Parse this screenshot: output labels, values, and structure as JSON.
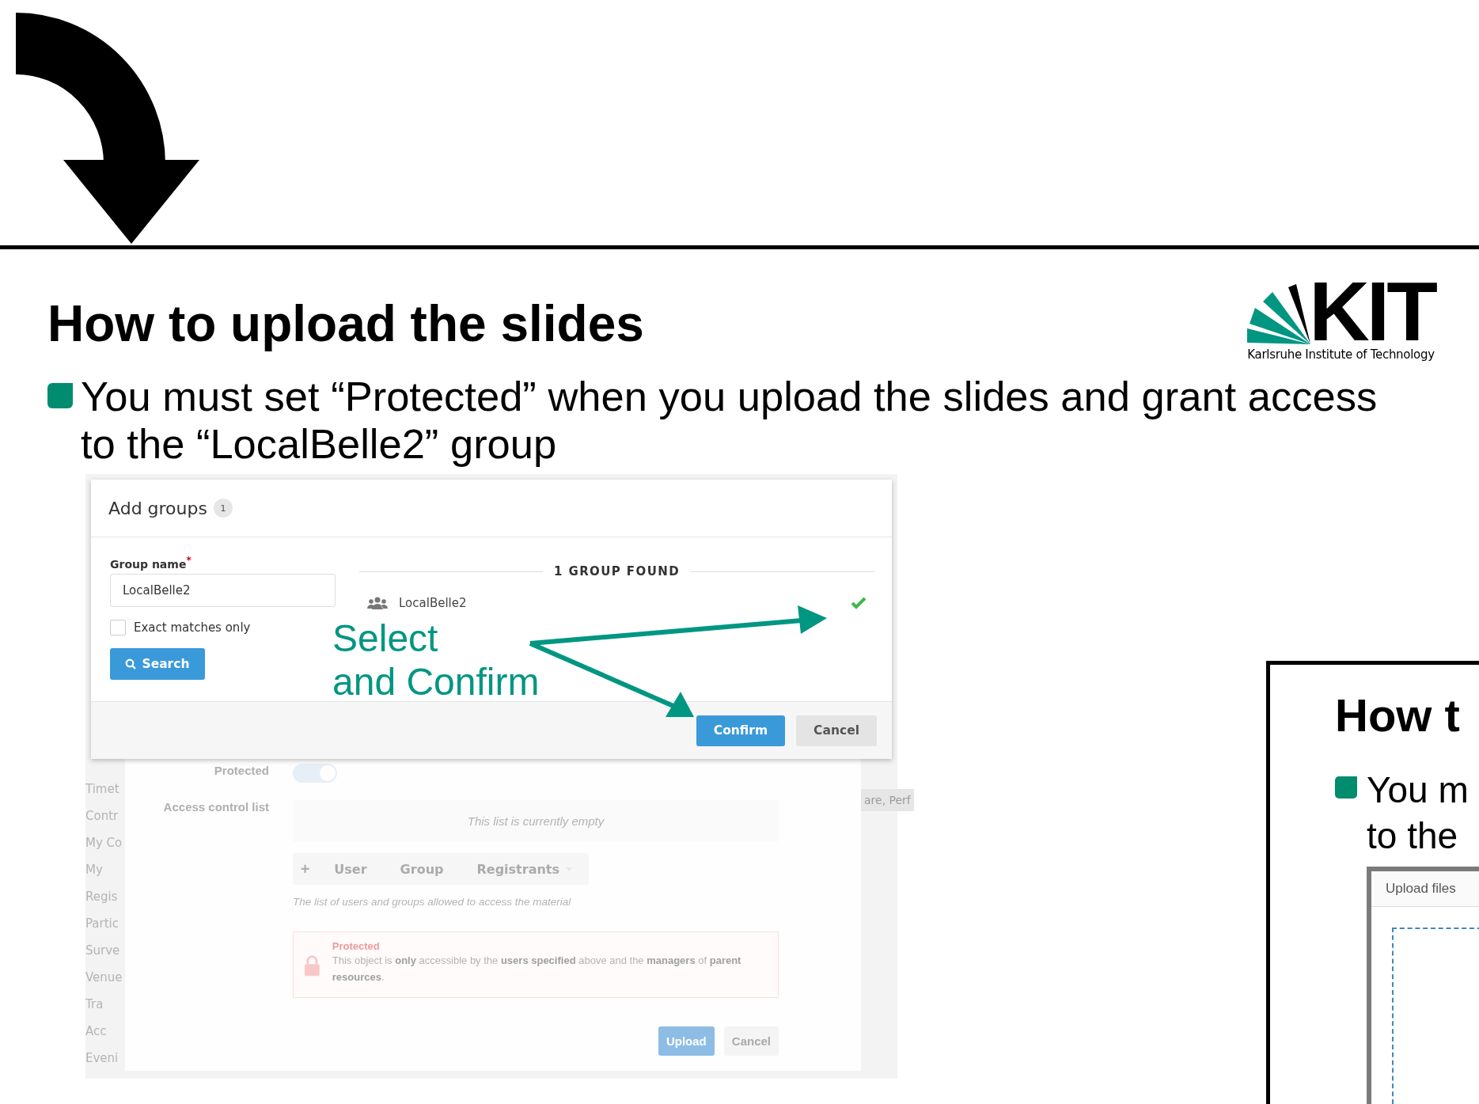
{
  "slide": {
    "title": "How to upload the slides",
    "bullet": "You must set “Protected” when you upload the slides and grant access to the “LocalBelle2” group",
    "logo": {
      "wordmark": "KIT",
      "subtitle": "Karlsruhe Institute of Technology"
    }
  },
  "screenshot": {
    "dialog": {
      "title": "Add groups",
      "count": "1",
      "field_label": "Group name",
      "required_mark": "*",
      "field_value": "LocalBelle2",
      "exact_only": {
        "label": "Exact matches only",
        "checked": false
      },
      "search_button": "Search",
      "results_heading": "1 GROUP FOUND",
      "results": [
        {
          "name": "LocalBelle2",
          "selected": true
        }
      ],
      "buttons": [
        {
          "label": "Confirm",
          "kind": "primary"
        },
        {
          "label": "Cancel",
          "kind": "secondary"
        }
      ]
    },
    "background_form": {
      "protected_label": "Protected",
      "protected_on": true,
      "acl_label": "Access control list",
      "acl_empty": "This list is currently empty",
      "add_buttons": [
        "User",
        "Group",
        "Registrants"
      ],
      "add_icon": "+",
      "hint": "The list of users and groups allowed to access the material",
      "notice_title": "Protected",
      "notice_text": "This object is **only** accessible by the **users specified** above and the **managers** of **parent resources**.",
      "buttons": [
        {
          "label": "Upload",
          "kind": "primary"
        },
        {
          "label": "Cancel",
          "kind": "secondary"
        }
      ]
    },
    "sidebar_fragments": [
      "Timet",
      "Contr",
      "My Co",
      "My",
      "Regis",
      "Partic",
      "Surve",
      "Venue",
      "Tra",
      "Acc",
      "Eveni"
    ],
    "tab_fragment": "are, Perf"
  },
  "annotation": {
    "lines": [
      "Select",
      "and Confirm"
    ]
  },
  "next_slide": {
    "title": "How t",
    "bullet_lines": [
      "You m",
      "to the"
    ],
    "screenshot_title": "Upload files"
  }
}
